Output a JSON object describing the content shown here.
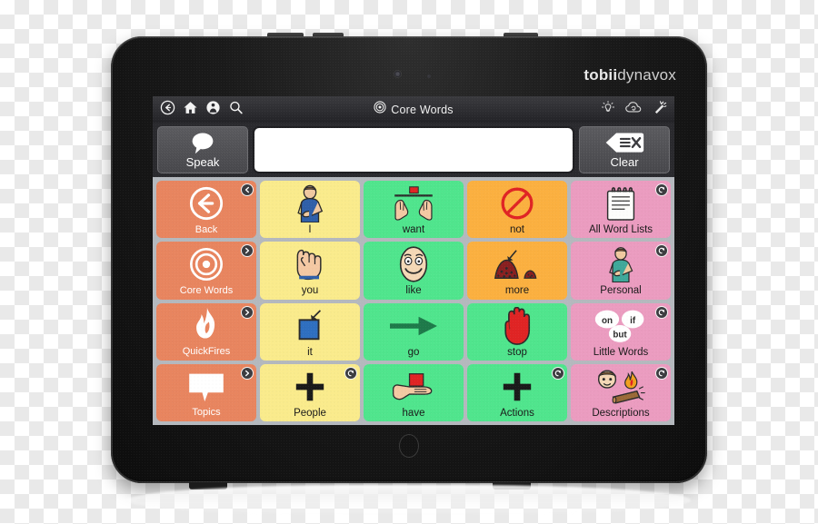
{
  "device": {
    "brand_bold": "tobii",
    "brand_light": "dynavox",
    "home_button_name": "home-button"
  },
  "titlebar": {
    "title": "Core Words",
    "title_icon": "target-icon",
    "nav_icons": [
      "back-circle-icon",
      "home-icon",
      "globe-person-icon",
      "search-icon"
    ],
    "status_icons": [
      "brightness-icon",
      "cloud-sync-icon",
      "magic-wand-icon"
    ]
  },
  "message_row": {
    "speak_label": "Speak",
    "speak_icon": "speech-bubble-icon",
    "clear_label": "Clear",
    "clear_icon": "backspace-clear-icon",
    "message_value": "",
    "message_placeholder": ""
  },
  "colors": {
    "nav_salmon": "#e8855f",
    "yellow": "#faeb8c",
    "green": "#50e58d",
    "orange": "#fbb040",
    "pink": "#eb9cc0",
    "grid_background": "#b4b8bd",
    "screen_chrome": "#2a2a2e",
    "badge_fill": "#3d3d41"
  },
  "grid": {
    "columns": 5,
    "rows": 4,
    "cells": [
      {
        "label": "Back",
        "color": "#e8855f",
        "text": "#ffffff",
        "type": "nav",
        "art": "back-arrow-circle-art",
        "badge": "arrow-left-badge"
      },
      {
        "label": "I",
        "color": "#faeb8c",
        "text": "#1a1a1a",
        "type": "word",
        "art": "person-pointing-self-art",
        "badge": null
      },
      {
        "label": "want",
        "color": "#50e58d",
        "text": "#1a1a1a",
        "type": "word",
        "art": "hands-want-art",
        "badge": null
      },
      {
        "label": "not",
        "color": "#fbb040",
        "text": "#1a1a1a",
        "type": "word",
        "art": "no-symbol-art",
        "badge": null
      },
      {
        "label": "All Word Lists",
        "color": "#eb9cc0",
        "text": "#1a1a1a",
        "type": "word",
        "art": "notepad-art",
        "badge": "refresh-badge"
      },
      {
        "label": "Core Words",
        "color": "#e8855f",
        "text": "#ffffff",
        "type": "nav",
        "art": "target-art",
        "badge": "arrow-right-badge"
      },
      {
        "label": "you",
        "color": "#faeb8c",
        "text": "#1a1a1a",
        "type": "word",
        "art": "hand-pointing-art",
        "badge": null
      },
      {
        "label": "like",
        "color": "#50e58d",
        "text": "#1a1a1a",
        "type": "word",
        "art": "smiling-face-art",
        "badge": null
      },
      {
        "label": "more",
        "color": "#fbb040",
        "text": "#1a1a1a",
        "type": "word",
        "art": "two-piles-art",
        "badge": null
      },
      {
        "label": "Personal",
        "color": "#eb9cc0",
        "text": "#1a1a1a",
        "type": "word",
        "art": "person-torso-art",
        "badge": "refresh-badge"
      },
      {
        "label": "QuickFires",
        "color": "#e8855f",
        "text": "#ffffff",
        "type": "nav",
        "art": "flame-art",
        "badge": "arrow-right-badge"
      },
      {
        "label": "it",
        "color": "#faeb8c",
        "text": "#1a1a1a",
        "type": "word",
        "art": "blue-square-arrow-art",
        "badge": null
      },
      {
        "label": "go",
        "color": "#50e58d",
        "text": "#1a1a1a",
        "type": "word",
        "art": "right-arrow-art",
        "badge": null
      },
      {
        "label": "stop",
        "color": "#50e58d",
        "text": "#1a1a1a",
        "type": "word",
        "art": "red-hand-art",
        "badge": null
      },
      {
        "label": "Little Words",
        "color": "#eb9cc0",
        "text": "#1a1a1a",
        "type": "word",
        "art": "word-bubbles-art",
        "badge": "refresh-badge"
      },
      {
        "label": "Topics",
        "color": "#e8855f",
        "text": "#ffffff",
        "type": "nav",
        "art": "speech-bubble-art",
        "badge": "arrow-right-badge"
      },
      {
        "label": "People",
        "color": "#faeb8c",
        "text": "#1a1a1a",
        "type": "word",
        "art": "plus-art",
        "badge": "refresh-badge"
      },
      {
        "label": "have",
        "color": "#50e58d",
        "text": "#1a1a1a",
        "type": "word",
        "art": "hand-holding-art",
        "badge": null
      },
      {
        "label": "Actions",
        "color": "#50e58d",
        "text": "#1a1a1a",
        "type": "word",
        "art": "plus-art",
        "badge": "refresh-badge"
      },
      {
        "label": "Descriptions",
        "color": "#eb9cc0",
        "text": "#1a1a1a",
        "type": "word",
        "art": "face-fire-log-art",
        "badge": "refresh-badge"
      }
    ]
  },
  "word_bubbles": {
    "a": "on",
    "b": "if",
    "c": "but"
  },
  "clear_glyph": "X"
}
